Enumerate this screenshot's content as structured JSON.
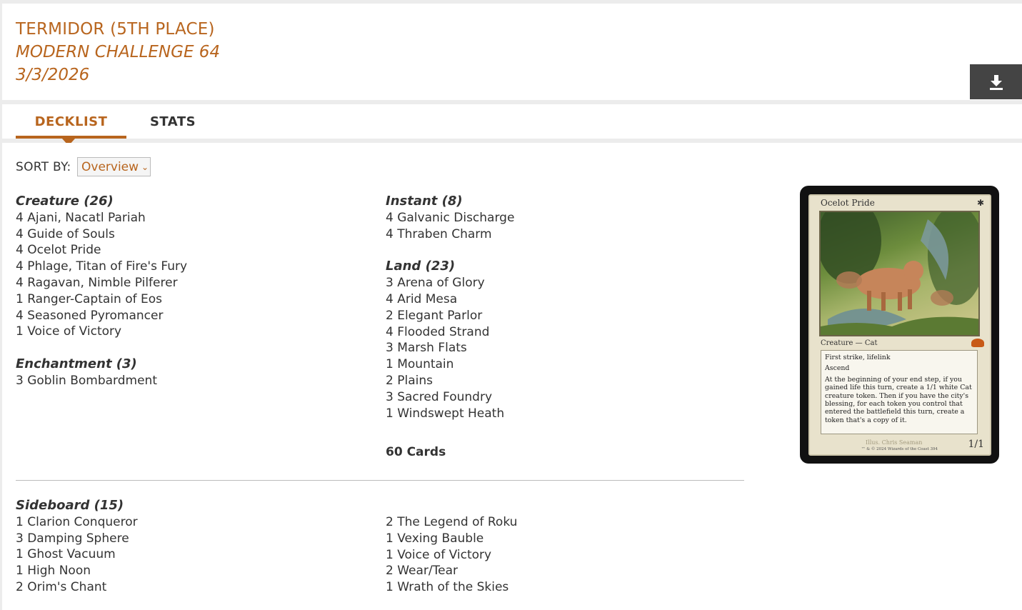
{
  "header": {
    "deck_title": "TERMIDOR (5TH PLACE)",
    "event_name": "MODERN CHALLENGE 64",
    "event_date": "3/3/2026",
    "download_icon": "download-icon"
  },
  "tabs": [
    {
      "label": "DECKLIST",
      "active": true
    },
    {
      "label": "STATS",
      "active": false
    }
  ],
  "sort": {
    "label": "SORT BY:",
    "selected": "Overview"
  },
  "main_deck": {
    "creature": {
      "heading": "Creature (26)",
      "cards": [
        "4 Ajani, Nacatl Pariah",
        "4 Guide of Souls",
        "4 Ocelot Pride",
        "4 Phlage, Titan of Fire's Fury",
        "4 Ragavan, Nimble Pilferer",
        "1 Ranger-Captain of Eos",
        "4 Seasoned Pyromancer",
        "1 Voice of Victory"
      ]
    },
    "enchantment": {
      "heading": "Enchantment (3)",
      "cards": [
        "3 Goblin Bombardment"
      ]
    },
    "instant": {
      "heading": "Instant (8)",
      "cards": [
        "4 Galvanic Discharge",
        "4 Thraben Charm"
      ]
    },
    "land": {
      "heading": "Land (23)",
      "cards": [
        "3 Arena of Glory",
        "4 Arid Mesa",
        "2 Elegant Parlor",
        "4 Flooded Strand",
        "3 Marsh Flats",
        "1 Mountain",
        "2 Plains",
        "3 Sacred Foundry",
        "1 Windswept Heath"
      ]
    },
    "total": "60 Cards"
  },
  "sideboard": {
    "heading": "Sideboard (15)",
    "left_cards": [
      "1 Clarion Conqueror",
      "3 Damping Sphere",
      "1 Ghost Vacuum",
      "1 High Noon",
      "2 Orim's Chant"
    ],
    "right_cards": [
      "2 The Legend of Roku",
      "1 Vexing Bauble",
      "1 Voice of Victory",
      "2 Wear/Tear",
      "1 Wrath of the Skies"
    ]
  },
  "card_preview": {
    "name": "Ocelot Pride",
    "type_line": "Creature — Cat",
    "rules_text": [
      "First strike, lifelink",
      "Ascend",
      "At the beginning of your end step, if you gained life this turn, create a 1/1 white Cat creature token. Then if you have the city's blessing, for each token you control that entered the battlefield this turn, create a token that's a copy of it."
    ],
    "power_toughness": "1/1",
    "artist": "Illus. Chris Seaman",
    "copyright": "™ & © 2024 Wizards of the Coast 394",
    "colors": {
      "frame": "#e8e2cc",
      "border": "#111111"
    }
  },
  "colors": {
    "accent": "#b8651e",
    "text": "#333333",
    "download_bg": "#444444"
  }
}
